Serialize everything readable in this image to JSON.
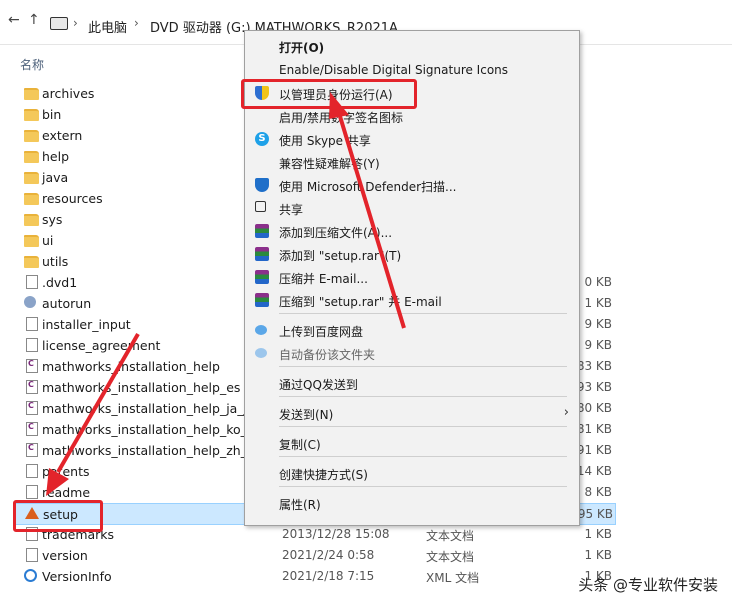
{
  "address": {
    "back_arrow": "←",
    "up_arrow": "↑",
    "sep": "›",
    "crumbs": [
      "此电脑",
      "DVD 驱动器 (G:) MATHWORKS_R2021A"
    ]
  },
  "column_header": "名称",
  "files": [
    {
      "name": "archives",
      "icon": "folder-icon",
      "date": "",
      "type": "",
      "size": ""
    },
    {
      "name": "bin",
      "icon": "folder-icon",
      "date": "",
      "type": "",
      "size": ""
    },
    {
      "name": "extern",
      "icon": "folder-icon",
      "date": "",
      "type": "",
      "size": ""
    },
    {
      "name": "help",
      "icon": "folder-icon",
      "date": "",
      "type": "",
      "size": ""
    },
    {
      "name": "java",
      "icon": "folder-icon",
      "date": "",
      "type": "",
      "size": ""
    },
    {
      "name": "resources",
      "icon": "folder-icon",
      "date": "",
      "type": "",
      "size": ""
    },
    {
      "name": "sys",
      "icon": "folder-icon",
      "date": "",
      "type": "",
      "size": ""
    },
    {
      "name": "ui",
      "icon": "folder-icon",
      "date": "",
      "type": "",
      "size": ""
    },
    {
      "name": "utils",
      "icon": "folder-icon",
      "date": "",
      "type": "",
      "size": ""
    },
    {
      "name": ".dvd1",
      "icon": "file-icon",
      "date": "",
      "type": "",
      "size": "0 KB"
    },
    {
      "name": "autorun",
      "icon": "gear-file-icon",
      "date": "",
      "type": "",
      "size": "1 KB"
    },
    {
      "name": "installer_input",
      "icon": "file-icon",
      "date": "",
      "type": "",
      "size": "9 KB"
    },
    {
      "name": "license_agreement",
      "icon": "file-icon",
      "date": "",
      "type": "",
      "size": "9 KB"
    },
    {
      "name": "mathworks_installation_help",
      "icon": "help-file-icon",
      "date": "",
      "type": "",
      "size": "83 KB"
    },
    {
      "name": "mathworks_installation_help_es",
      "icon": "help-file-icon",
      "date": "",
      "type": "",
      "size": "93 KB"
    },
    {
      "name": "mathworks_installation_help_ja_JP",
      "icon": "help-file-icon",
      "date": "",
      "type": "",
      "size": "80 KB"
    },
    {
      "name": "mathworks_installation_help_ko_KR",
      "icon": "help-file-icon",
      "date": "",
      "type": "",
      "size": "81 KB"
    },
    {
      "name": "mathworks_installation_help_zh_CN",
      "icon": "help-file-icon",
      "date": "",
      "type": "",
      "size": "91 KB"
    },
    {
      "name": "patents",
      "icon": "file-icon",
      "date": "",
      "type": "",
      "size": "14 KB"
    },
    {
      "name": "readme",
      "icon": "file-icon",
      "date": "",
      "type": "",
      "size": "8 KB"
    },
    {
      "name": "setup",
      "icon": "matlab-icon",
      "date": "",
      "type": "",
      "size": "95 KB"
    },
    {
      "name": "trademarks",
      "icon": "file-icon",
      "date": "2013/12/28 15:08",
      "type": "文本文档",
      "size": "1 KB"
    },
    {
      "name": "version",
      "icon": "file-icon",
      "date": "2021/2/24 0:58",
      "type": "文本文档",
      "size": "1 KB"
    },
    {
      "name": "VersionInfo",
      "icon": "xml-icon",
      "date": "2021/2/18 7:15",
      "type": "XML 文档",
      "size": "1 KB"
    }
  ],
  "context_menu": [
    {
      "label": "打开(O)",
      "icon": "",
      "bold": true
    },
    {
      "label": "Enable/Disable Digital Signature Icons",
      "icon": ""
    },
    {
      "label": "以管理员身份运行(A)",
      "icon": "uac-shield-icon",
      "highlight": true
    },
    {
      "label": "启用/禁用数字签名图标",
      "icon": ""
    },
    {
      "label": "使用 Skype 共享",
      "icon": "skype-icon"
    },
    {
      "label": "兼容性疑难解答(Y)",
      "icon": ""
    },
    {
      "label": "使用 Microsoft Defender扫描...",
      "icon": "defender-icon"
    },
    {
      "label": "共享",
      "icon": "share-icon"
    },
    {
      "label": "添加到压缩文件(A)...",
      "icon": "winrar-icon"
    },
    {
      "label": "添加到 \"setup.rar\"(T)",
      "icon": "winrar-icon"
    },
    {
      "label": "压缩并 E-mail...",
      "icon": "winrar-icon"
    },
    {
      "label": "压缩到 \"setup.rar\" 并 E-mail",
      "icon": "winrar-icon"
    },
    {
      "label": "上传到百度网盘",
      "icon": "baidu-cloud-icon"
    },
    {
      "label": "自动备份该文件夹",
      "icon": "baidu-cloud-icon",
      "dim": true
    },
    {
      "label": "通过QQ发送到",
      "icon": ""
    },
    {
      "label": "发送到(N)",
      "icon": "",
      "submenu": true
    },
    {
      "label": "复制(C)",
      "icon": ""
    },
    {
      "label": "创建快捷方式(S)",
      "icon": ""
    },
    {
      "label": "属性(R)",
      "icon": ""
    }
  ],
  "submenu_arrow": "›",
  "annotation_color": "#e3242b",
  "watermark": "头条 @专业软件安装"
}
